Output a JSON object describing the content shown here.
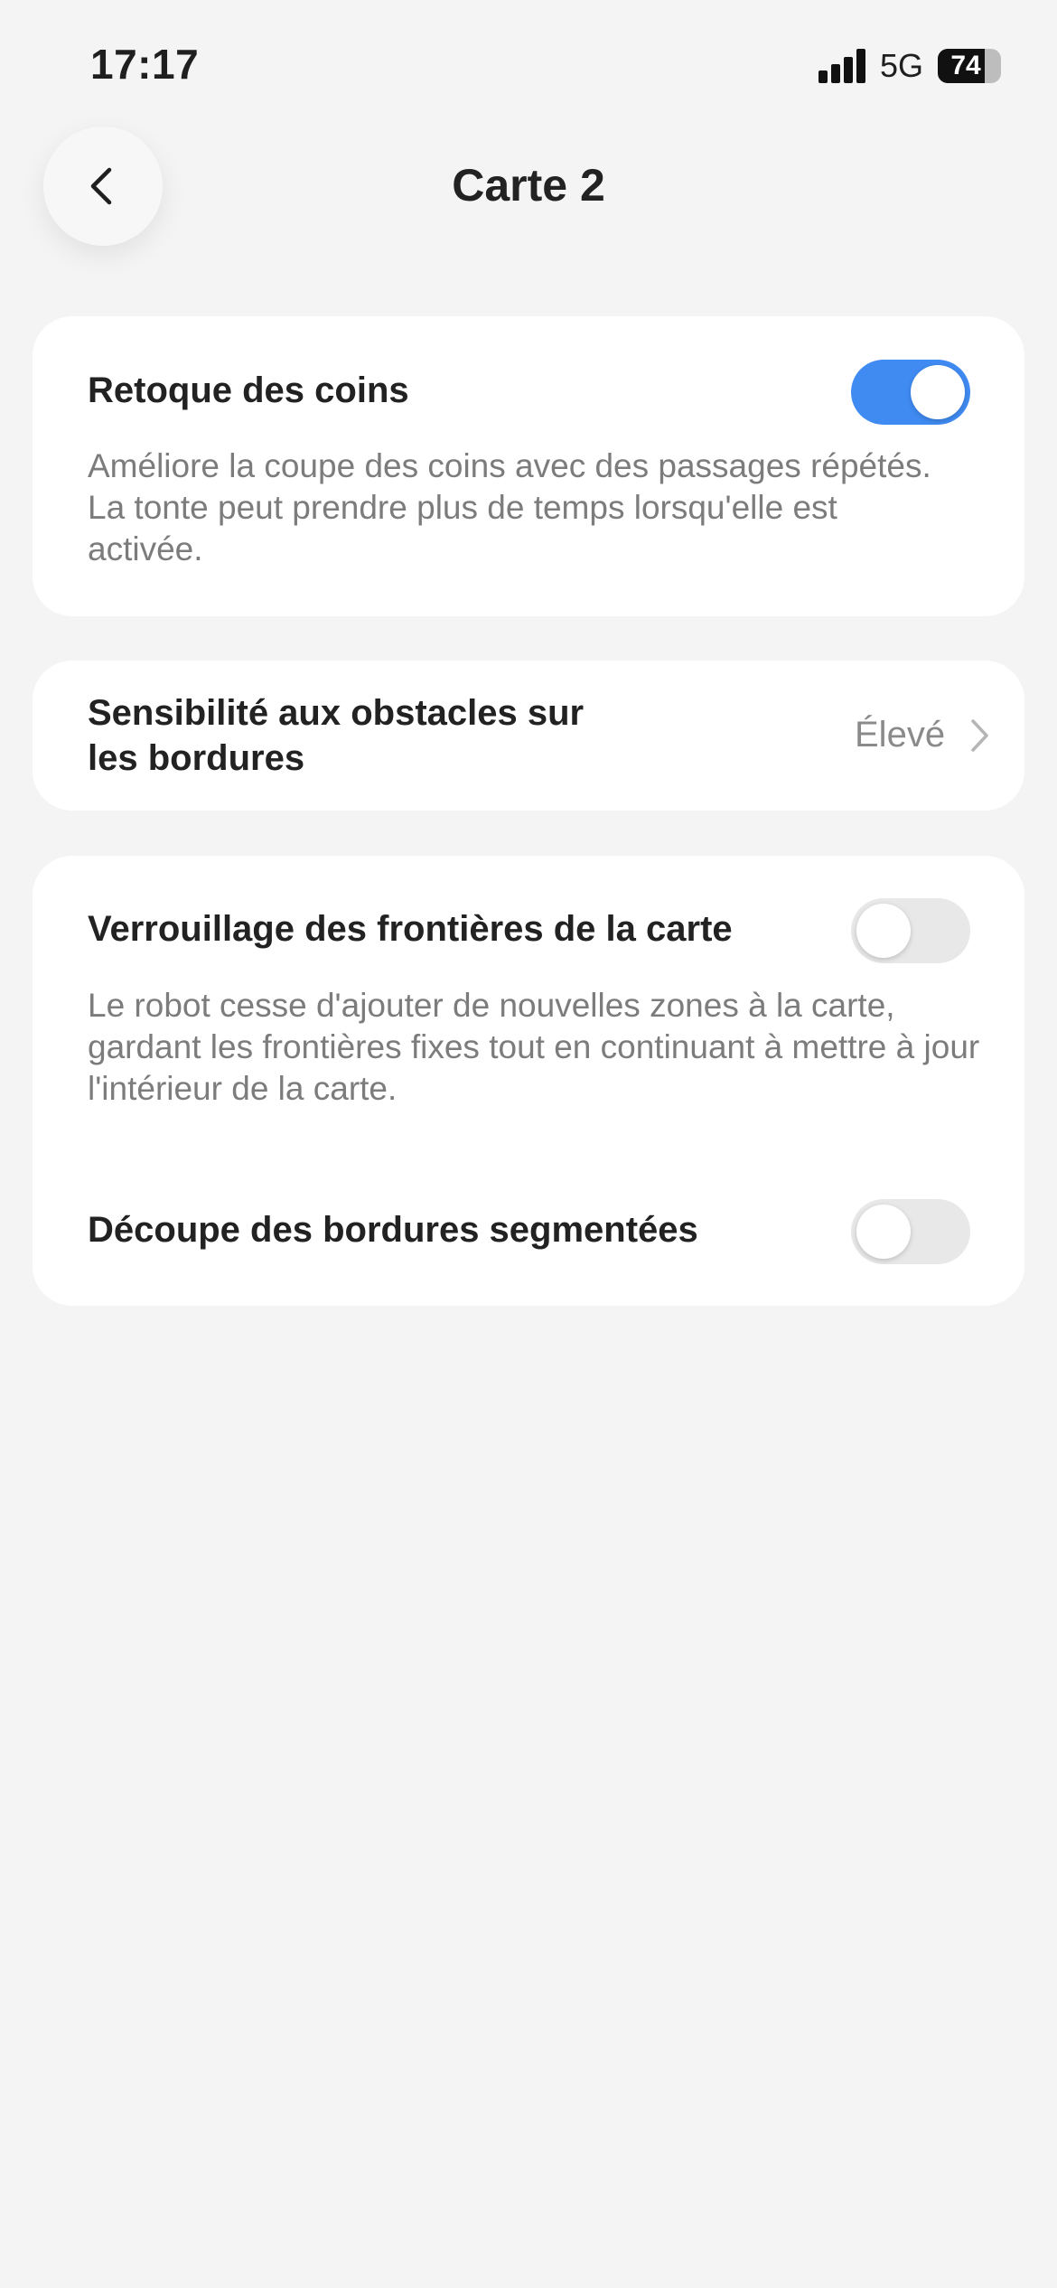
{
  "status_bar": {
    "time": "17:17",
    "network": "5G",
    "battery_percent": "74",
    "battery_level": 0.74,
    "signal_bars": 4
  },
  "header": {
    "title": "Carte 2",
    "back_icon": "chevron-left-icon"
  },
  "settings": {
    "corner_retouch": {
      "label": "Retoque des coins",
      "description": "Améliore la coupe des coins avec des passages répétés. La tonte peut prendre plus de temps lorsqu'elle est activée.",
      "enabled": true
    },
    "edge_obstacle_sensitivity": {
      "label_line1": "Sensibilité aux obstacles sur",
      "label_line2": "les bordures",
      "value": "Élevé",
      "icon": "chevron-right-icon"
    },
    "map_boundary_lock": {
      "label": "Verrouillage des frontières de la carte",
      "description": "Le robot cesse d'ajouter de nouvelles zones à la carte, gardant les frontières fixes tout en continuant à mettre à jour l'intérieur de la carte.",
      "enabled": false
    },
    "segmented_edge_cut": {
      "label": "Découpe des bordures segmentées",
      "enabled": false
    }
  },
  "colors": {
    "accent": "#3f8bf2",
    "background": "#f4f4f4",
    "card": "#ffffff",
    "toggle_off": "#e8e8e8"
  }
}
